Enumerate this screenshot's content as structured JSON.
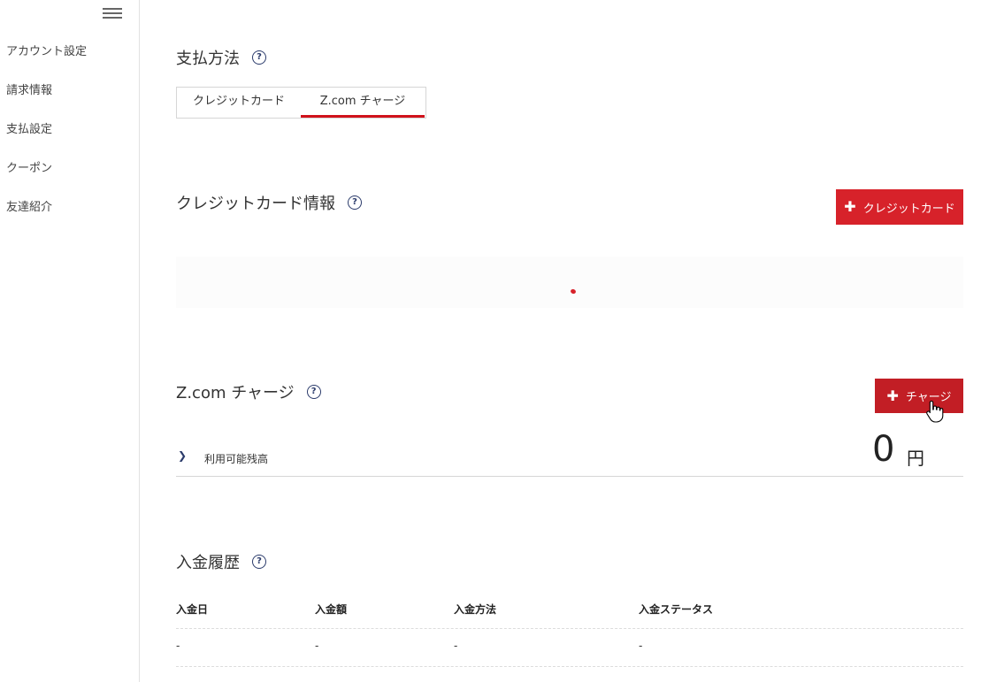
{
  "sidebar": {
    "items": [
      {
        "label": "アカウント設定"
      },
      {
        "label": "請求情報"
      },
      {
        "label": "支払設定"
      },
      {
        "label": "クーポン"
      },
      {
        "label": "友達紹介"
      }
    ]
  },
  "payment_method": {
    "title": "支払方法",
    "help": "?",
    "tabs": [
      {
        "label": "クレジットカード",
        "active": false
      },
      {
        "label": "Z.com チャージ",
        "active": true
      }
    ]
  },
  "credit_card": {
    "title": "クレジットカード情報",
    "help": "?",
    "add_button_label": "クレジットカード"
  },
  "charge": {
    "title": "Z.com チャージ",
    "help": "?",
    "charge_button_label": "チャージ",
    "balance_label": "利用可能残高",
    "balance_amount": "0",
    "balance_unit": "円"
  },
  "history": {
    "title": "入金履歴",
    "help": "?",
    "columns": [
      "入金日",
      "入金額",
      "入金方法",
      "入金ステータス"
    ],
    "rows": [
      [
        "-",
        "-",
        "-",
        "-"
      ]
    ]
  },
  "colors": {
    "accent": "#d7222a",
    "help_icon": "#2b3b6b"
  }
}
